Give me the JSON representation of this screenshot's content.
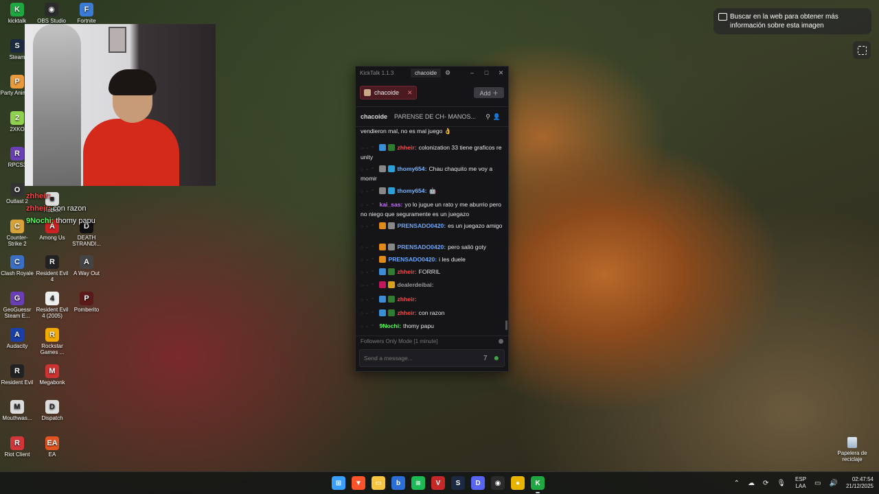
{
  "desktop": {
    "icons": [
      {
        "label": "kicktalk",
        "color": "#1fa842",
        "glyph": "K"
      },
      {
        "label": "OBS Studio",
        "color": "#2b2b2b",
        "glyph": "◉"
      },
      {
        "label": "Fortnite",
        "color": "#3a7bd5",
        "glyph": "F"
      },
      {
        "label": "Steam",
        "color": "#1b2a40",
        "glyph": "S"
      },
      {
        "label": "Party Animals",
        "color": "#e89a3c",
        "glyph": "P"
      },
      {
        "label": "2XKO",
        "color": "#8fd14f",
        "glyph": "2"
      },
      {
        "label": "RPCS3",
        "color": "#6a3fb5",
        "glyph": "R"
      },
      {
        "label": "Outlast 2",
        "color": "#333",
        "glyph": "O"
      },
      {
        "label": "Roblox",
        "color": "#ddd",
        "glyph": "■"
      },
      {
        "label": "Counter-Strike 2",
        "color": "#d8a23a",
        "glyph": "C"
      },
      {
        "label": "Among Us",
        "color": "#c22",
        "glyph": "A"
      },
      {
        "label": "DEATH STRANDI...",
        "color": "#111",
        "glyph": "D"
      },
      {
        "label": "Clash Royale",
        "color": "#3a6fc4",
        "glyph": "C"
      },
      {
        "label": "Resident Evil 4",
        "color": "#222",
        "glyph": "R"
      },
      {
        "label": "A Way Out",
        "color": "#444",
        "glyph": "A"
      },
      {
        "label": "GeoGuessr Steam E...",
        "color": "#6a3fb5",
        "glyph": "G"
      },
      {
        "label": "Resident Evil 4 (2005)",
        "color": "#eee",
        "glyph": "4"
      },
      {
        "label": "Pomberito",
        "color": "#5a1a1a",
        "glyph": "P"
      },
      {
        "label": "Audacity",
        "color": "#1a3fa8",
        "glyph": "A"
      },
      {
        "label": "Rockstar Games ...",
        "color": "#f2a900",
        "glyph": "R"
      },
      {
        "label": "Resident Evil",
        "color": "#222",
        "glyph": "R"
      },
      {
        "label": "Megabonk",
        "color": "#c33",
        "glyph": "M"
      },
      {
        "label": "Mouthwas...",
        "color": "#ddd",
        "glyph": "M"
      },
      {
        "label": "Dispatch",
        "color": "#ddd",
        "glyph": "D"
      },
      {
        "label": "Riot Client",
        "color": "#d13639",
        "glyph": "R"
      },
      {
        "label": "EA",
        "color": "#e45420",
        "glyph": "EA"
      }
    ],
    "recycle_bin": "Papelera de reciclaje"
  },
  "overlay_chat": [
    {
      "user": "zhheir:",
      "text": "",
      "user_color": "#ff4444"
    },
    {
      "user": "zhheir:",
      "text": "con razon",
      "user_color": "#ff4444"
    },
    {
      "user": "9Nochi:",
      "text": "thomy    papu",
      "user_color": "#5aff5a"
    }
  ],
  "kicktalk": {
    "app_title": "KickTalk 1.1.3",
    "title_tab": "chacoide",
    "channel_tab": "chacoide",
    "add_label": "Add ＋",
    "header_channel": "chacoide",
    "header_title": "PARENSE DE CH- MANOS...",
    "messages": [
      {
        "badges": [],
        "user": "",
        "user_color": "#ffffff",
        "text": "vendieron mal, no es mal juego 👌"
      },
      {
        "badges": [
          "#3a8fd8",
          "#2e7d32"
        ],
        "user": "zhheir:",
        "user_color": "#ff4a4a",
        "text": "colonization 33 tiene graficos re unity"
      },
      {
        "badges": [
          "#888",
          "#2a9fd8"
        ],
        "user": "thomy654:",
        "user_color": "#7ab4ff",
        "text": "Chau chaquito me voy a momir"
      },
      {
        "badges": [
          "#888",
          "#2a9fd8"
        ],
        "user": "thomy654:",
        "user_color": "#7ab4ff",
        "text": "🤖"
      },
      {
        "badges": [],
        "user": "kai_sas:",
        "user_color": "#c86fff",
        "text": "yo lo jugue un rato y me aburrio pero no niego que seguramente es un juegazo"
      },
      {
        "badges": [
          "#e08a1a",
          "#888"
        ],
        "user": "PRENSADO0420:",
        "user_color": "#6aa8ff",
        "text": "es un juegazo amigo"
      },
      {
        "badges": [
          "#e08a1a",
          "#888"
        ],
        "user": "PRENSADO0420:",
        "user_color": "#6aa8ff",
        "text": "pero salió goty"
      },
      {
        "badges": [
          "#e08a1a"
        ],
        "user": "PRENSADO0420:",
        "user_color": "#6aa8ff",
        "text": "i les duele"
      },
      {
        "badges": [
          "#3a8fd8",
          "#2e7d32"
        ],
        "user": "zhheir:",
        "user_color": "#ff4a4a",
        "text": "FORRIL"
      },
      {
        "badges": [
          "#c2185b",
          "#d8a31a"
        ],
        "user": "dealerdeibai:",
        "user_color": "#9a9a9a",
        "text": ""
      },
      {
        "badges": [
          "#3a8fd8",
          "#2e7d32"
        ],
        "user": "zhheir:",
        "user_color": "#ff4a4a",
        "text": ""
      },
      {
        "badges": [
          "#3a8fd8",
          "#2e7d32"
        ],
        "user": "zhheir:",
        "user_color": "#ff4a4a",
        "text": "con razon"
      },
      {
        "badges": [],
        "user": "9Nochi:",
        "user_color": "#5aff5a",
        "text": "thomy          papu"
      }
    ],
    "mode_text": "Followers Only Mode [1 minute]",
    "input_placeholder": "Send a message..."
  },
  "lens": {
    "text": "Buscar en la web para obtener más información sobre esta imagen"
  },
  "taskbar": {
    "apps": [
      {
        "name": "start",
        "color": "#3aa0ff",
        "glyph": "⊞"
      },
      {
        "name": "brave",
        "color": "#fb542b",
        "glyph": "▼"
      },
      {
        "name": "explorer",
        "color": "#f5c542",
        "glyph": "▭"
      },
      {
        "name": "bing",
        "color": "#2b6fd6",
        "glyph": "b"
      },
      {
        "name": "spotify",
        "color": "#1db954",
        "glyph": "≋"
      },
      {
        "name": "voicemeeter",
        "color": "#c62828",
        "glyph": "V"
      },
      {
        "name": "steam",
        "color": "#1b2a40",
        "glyph": "S"
      },
      {
        "name": "discord",
        "color": "#5865f2",
        "glyph": "D"
      },
      {
        "name": "obs",
        "color": "#2b2b2b",
        "glyph": "◉"
      },
      {
        "name": "chrome",
        "color": "#e8b400",
        "glyph": "●"
      },
      {
        "name": "kicktalk",
        "color": "#1fa842",
        "glyph": "K"
      }
    ],
    "lang_top": "ESP",
    "lang_bottom": "LAA",
    "time": "02:47:54",
    "date": "21/12/2025"
  }
}
